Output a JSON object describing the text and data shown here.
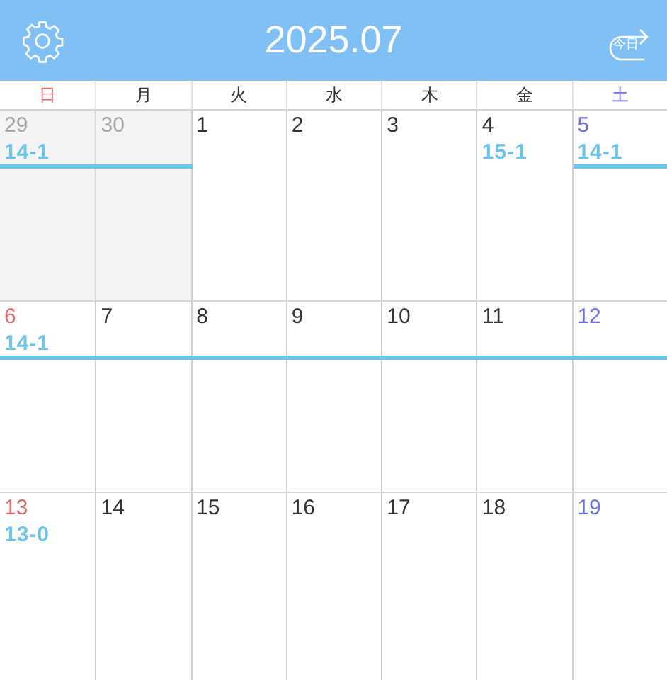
{
  "header": {
    "title": "2025.07",
    "today_button": "今日"
  },
  "weekdays": [
    {
      "label": "日",
      "kind": "sun"
    },
    {
      "label": "月",
      "kind": "weekday"
    },
    {
      "label": "火",
      "kind": "weekday"
    },
    {
      "label": "水",
      "kind": "weekday"
    },
    {
      "label": "木",
      "kind": "weekday"
    },
    {
      "label": "金",
      "kind": "weekday"
    },
    {
      "label": "土",
      "kind": "sat"
    }
  ],
  "weeks": [
    [
      {
        "date": "29",
        "kind": "sun",
        "other_month": true,
        "event": "14-1",
        "bar": true
      },
      {
        "date": "30",
        "kind": "weekday",
        "other_month": true,
        "bar": true
      },
      {
        "date": "1",
        "kind": "weekday",
        "other_month": false,
        "bar": false
      },
      {
        "date": "2",
        "kind": "weekday",
        "other_month": false,
        "bar": false
      },
      {
        "date": "3",
        "kind": "weekday",
        "other_month": false,
        "bar": false
      },
      {
        "date": "4",
        "kind": "weekday",
        "other_month": false,
        "event": "15-1",
        "bar": false
      },
      {
        "date": "5",
        "kind": "sat",
        "other_month": false,
        "event": "14-1",
        "bar": true
      }
    ],
    [
      {
        "date": "6",
        "kind": "sun",
        "other_month": false,
        "event": "14-1",
        "bar": true
      },
      {
        "date": "7",
        "kind": "weekday",
        "other_month": false,
        "bar": true
      },
      {
        "date": "8",
        "kind": "weekday",
        "other_month": false,
        "bar": true
      },
      {
        "date": "9",
        "kind": "weekday",
        "other_month": false,
        "bar": true
      },
      {
        "date": "10",
        "kind": "weekday",
        "other_month": false,
        "bar": true
      },
      {
        "date": "11",
        "kind": "weekday",
        "other_month": false,
        "bar": true
      },
      {
        "date": "12",
        "kind": "sat",
        "other_month": false,
        "bar": true
      }
    ],
    [
      {
        "date": "13",
        "kind": "sun",
        "other_month": false,
        "event": "13-0",
        "bar": false
      },
      {
        "date": "14",
        "kind": "weekday",
        "other_month": false,
        "bar": false
      },
      {
        "date": "15",
        "kind": "weekday",
        "other_month": false,
        "bar": false
      },
      {
        "date": "16",
        "kind": "weekday",
        "other_month": false,
        "bar": false
      },
      {
        "date": "17",
        "kind": "weekday",
        "other_month": false,
        "bar": false
      },
      {
        "date": "18",
        "kind": "weekday",
        "other_month": false,
        "bar": false
      },
      {
        "date": "19",
        "kind": "sat",
        "other_month": false,
        "bar": false
      }
    ]
  ]
}
